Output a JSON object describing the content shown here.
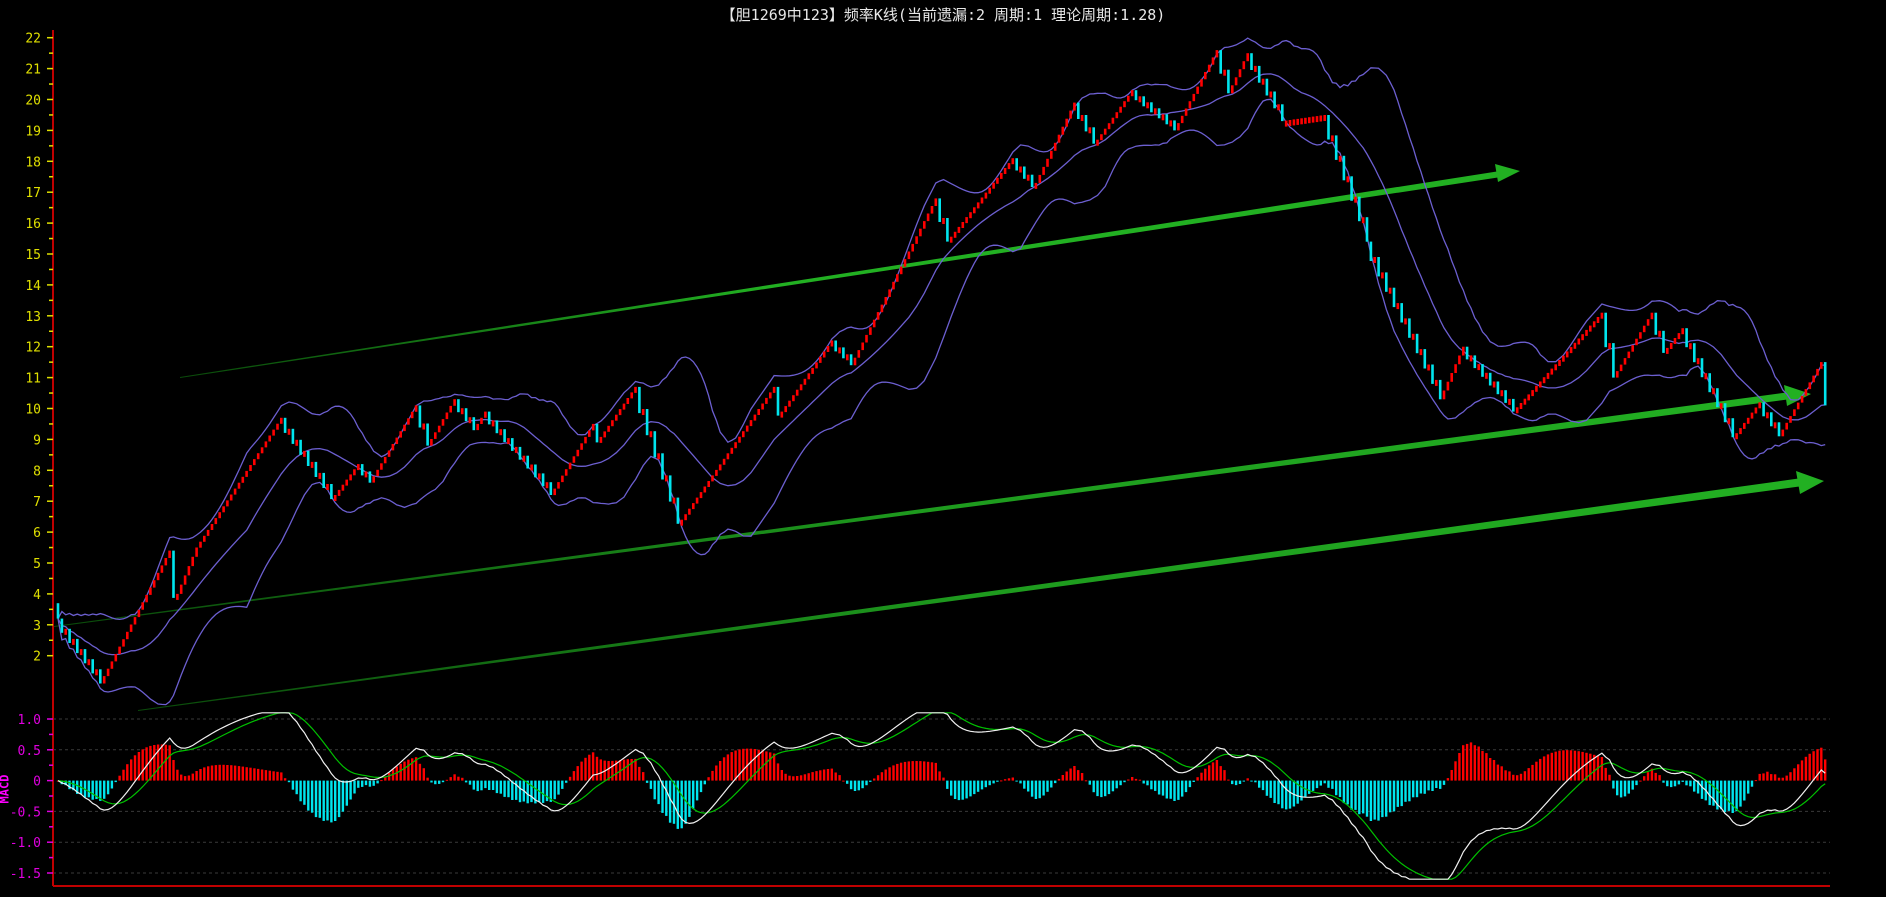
{
  "title": "【胆1269中123】频率K线(当前遗漏:2 周期:1 理论周期:1.28)",
  "chart_data": {
    "type": "candlestick",
    "title": "【胆1269中123】频率K线(当前遗漏:2 周期:1 理论周期:1.28)",
    "main_panel": {
      "ylim": [
        2,
        22
      ],
      "y_ticks": [
        "22",
        "21",
        "20",
        "19",
        "18",
        "17",
        "16",
        "15",
        "14",
        "13",
        "12",
        "11",
        "10",
        "9",
        "8",
        "7",
        "6",
        "5",
        "4",
        "3",
        "2"
      ],
      "y_tick_values": [
        22,
        21,
        20,
        19,
        18,
        17,
        16,
        15,
        14,
        13,
        12,
        11,
        10,
        9,
        8,
        7,
        6,
        5,
        4,
        3,
        2
      ],
      "bar_count": 460,
      "up_step": 0.13,
      "path_turning_points": [
        [
          0,
          3.2
        ],
        [
          11,
          1.1
        ],
        [
          29,
          5.4
        ],
        [
          31,
          4.0
        ],
        [
          36,
          5.5
        ],
        [
          58,
          9.7
        ],
        [
          72,
          7.2
        ],
        [
          78,
          8.2
        ],
        [
          81,
          7.6
        ],
        [
          93,
          10.1
        ],
        [
          96,
          8.8
        ],
        [
          103,
          10.3
        ],
        [
          108,
          9.3
        ],
        [
          111,
          9.9
        ],
        [
          128,
          7.2
        ],
        [
          139,
          9.5
        ],
        [
          140,
          8.9
        ],
        [
          150,
          10.7
        ],
        [
          162,
          6.4
        ],
        [
          186,
          10.7
        ],
        [
          188,
          9.9
        ],
        [
          201,
          12.2
        ],
        [
          206,
          11.4
        ],
        [
          228,
          16.8
        ],
        [
          231,
          15.4
        ],
        [
          248,
          18.1
        ],
        [
          254,
          17.3
        ],
        [
          264,
          19.9
        ],
        [
          270,
          18.7
        ],
        [
          279,
          20.3
        ],
        [
          290,
          19.0
        ],
        [
          301,
          21.6
        ],
        [
          304,
          20.2
        ],
        [
          309,
          21.5
        ],
        [
          318,
          19.3
        ],
        [
          329,
          19.5
        ],
        [
          340,
          15.4
        ],
        [
          359,
          10.3
        ],
        [
          365,
          12.0
        ],
        [
          378,
          9.9
        ],
        [
          401,
          13.1
        ],
        [
          404,
          11.0
        ],
        [
          414,
          13.1
        ],
        [
          417,
          11.8
        ],
        [
          422,
          12.6
        ],
        [
          436,
          9.2
        ],
        [
          442,
          10.2
        ],
        [
          447,
          9.1
        ],
        [
          458,
          11.5
        ],
        [
          459,
          10.1
        ]
      ],
      "bollinger": {
        "period": 20,
        "k": 2
      },
      "colors": {
        "up": "#ff0000",
        "down": "#00e5ee",
        "bands": "#6c5fd0",
        "trend": "#22b022",
        "axis": "#c00000",
        "tick": "#e0e000"
      }
    },
    "macd_panel": {
      "label": "MACD",
      "ylim": [
        -1.6,
        1.1
      ],
      "y_ticks": [
        "1.0",
        "0.5",
        "0",
        "-0.5",
        "-1.0",
        "-1.5"
      ],
      "y_tick_values": [
        1.0,
        0.5,
        0,
        -0.5,
        -1.0,
        -1.5
      ],
      "params": {
        "fast": 12,
        "slow": 26,
        "signal": 9
      },
      "colors": {
        "dif": "#f0f0f0",
        "dea": "#00c000",
        "hist_pos": "#ff0000",
        "hist_neg": "#00e5ee",
        "tick": "#e000e0"
      }
    }
  }
}
